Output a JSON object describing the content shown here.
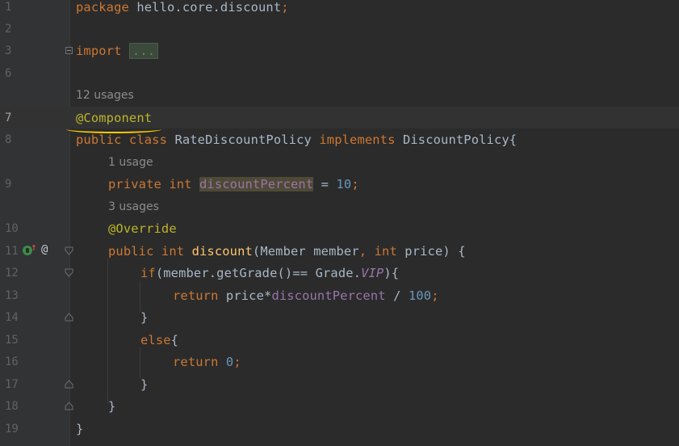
{
  "editor": {
    "lines": [
      {
        "n": "1",
        "code": "package hello.core.discount;"
      },
      {
        "n": "2"
      },
      {
        "n": "3",
        "code": "import ..."
      },
      {
        "n": "6"
      },
      {
        "n": "7",
        "code": "@Component"
      },
      {
        "n": "8",
        "code": "public class RateDiscountPolicy implements DiscountPolicy{"
      },
      {
        "n": "9",
        "code": "private int discountPercent = 10;"
      },
      {
        "n": "10",
        "code": "@Override"
      },
      {
        "n": "11",
        "code": "public int discount(Member member, int price) {"
      },
      {
        "n": "12",
        "code": "if(member.getGrade()== Grade.VIP){"
      },
      {
        "n": "13",
        "code": "return price*discountPercent / 100;"
      },
      {
        "n": "14",
        "code": "}"
      },
      {
        "n": "15",
        "code": "else{"
      },
      {
        "n": "16",
        "code": "return 0;"
      },
      {
        "n": "17",
        "code": "}"
      },
      {
        "n": "18",
        "code": "}"
      },
      {
        "n": "19",
        "code": "}"
      }
    ],
    "hints": {
      "class_usages": "12 usages",
      "field_usages": "1 usage",
      "method_usages": "3 usages"
    },
    "tokens": {
      "package_kw": "package",
      "package_name": "hello.core.discount",
      "import_kw": "import",
      "import_collapsed": "...",
      "annotation_component": "@Component",
      "public_kw": "public",
      "class_kw": "class",
      "class_name": "RateDiscountPolicy",
      "implements_kw": "implements",
      "interface_name": "DiscountPolicy",
      "private_kw": "private",
      "int_kw": "int",
      "field_name": "discountPercent",
      "field_value": "10",
      "annotation_override": "@Override",
      "method_name": "discount",
      "param_type": "Member",
      "param_member": "member",
      "param_price": "price",
      "if_kw": "if",
      "get_grade": "member.getGrade()",
      "grade_class": "Grade.",
      "grade_vip": "VIP",
      "return_kw": "return",
      "price": "price",
      "divisor": "100",
      "else_kw": "else",
      "zero": "0"
    }
  },
  "colors": {
    "background": "#2b2b2b",
    "gutter": "#313335",
    "keyword": "#cc7832",
    "annotation": "#bbb529",
    "number": "#6897bb",
    "field": "#9876aa",
    "method": "#ffc66d",
    "text": "#a9b7c6",
    "underline": "#ffd000"
  },
  "gutter_icons": [
    "implements-icon",
    "override-up-arrow-icon",
    "annotation-at-icon"
  ]
}
